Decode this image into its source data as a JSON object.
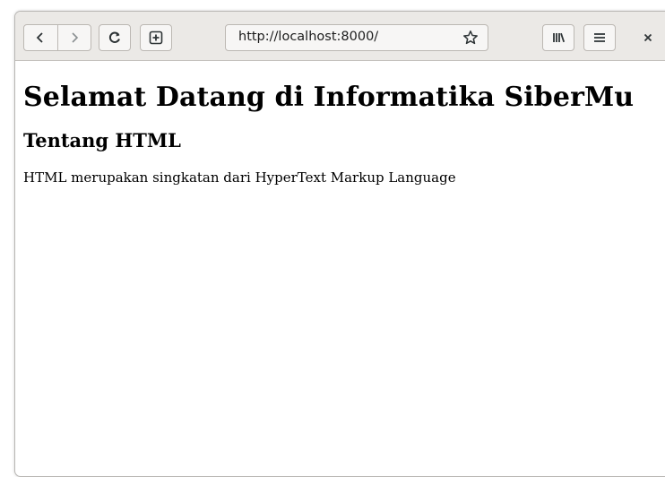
{
  "browser": {
    "url": "http://localhost:8000/",
    "buttons": {
      "back": "back-icon",
      "forward": "forward-icon",
      "reload": "reload-icon",
      "new_tab": "new-tab-icon",
      "bookmark": "star-icon",
      "library": "library-icon",
      "menu": "hamburger-menu-icon",
      "close": "close-icon"
    }
  },
  "page": {
    "heading": "Selamat Datang di Informatika SiberMu",
    "subheading": "Tentang HTML",
    "paragraph": "HTML merupakan singkatan dari HyperText Markup Language"
  }
}
